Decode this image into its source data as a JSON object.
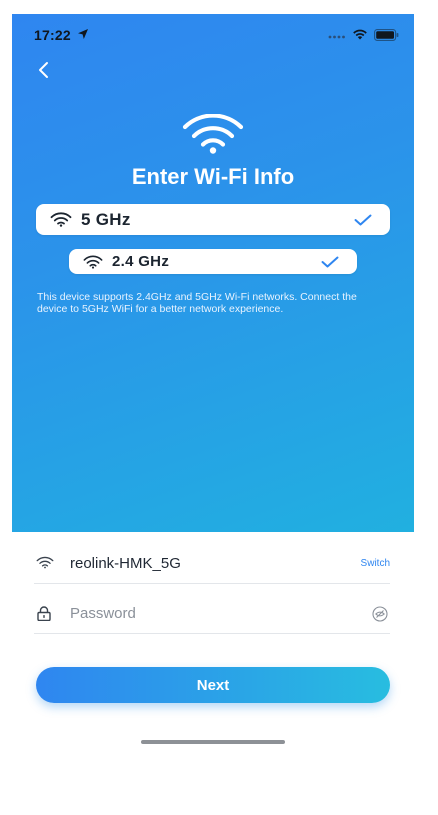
{
  "status_bar": {
    "time": "17:22",
    "icons": [
      "location-arrow-icon",
      "signal-dots-icon",
      "wifi-icon",
      "battery-icon"
    ]
  },
  "nav": {
    "back_icon": "chevron-left-icon"
  },
  "hero": {
    "icon": "wifi-icon",
    "title": "Enter Wi-Fi Info",
    "bands": [
      {
        "label": "5 GHz",
        "icon": "wifi-icon",
        "selected_icon": "checkmark-icon"
      },
      {
        "label": "2.4 GHz",
        "icon": "wifi-icon",
        "selected_icon": "checkmark-icon"
      }
    ],
    "note": "This device supports 2.4GHz and 5GHz Wi-Fi networks. Connect the device to 5GHz WiFi for a better network experience."
  },
  "form": {
    "ssid": {
      "icon": "wifi-icon",
      "value": "reolink-HMK_5G",
      "switch_label": "Switch"
    },
    "password": {
      "icon": "lock-icon",
      "value": "",
      "placeholder": "Password",
      "toggle_icon": "eye-hidden-icon"
    }
  },
  "next_label": "Next",
  "colors": {
    "accent": "#2f86f0",
    "gradient_end": "#21b0e0",
    "text_primary": "#1f2733",
    "placeholder": "#8a9099"
  }
}
